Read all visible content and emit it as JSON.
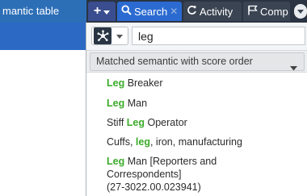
{
  "left_tab": {
    "label": "mantic table"
  },
  "tabs": {
    "add_label": "+",
    "search_label": "Search",
    "search_close": "✕",
    "activity_label": "Activity",
    "comp_label": "Comp"
  },
  "search": {
    "value": "leg"
  },
  "sort": {
    "selected": "Matched semantic with score order"
  },
  "results": [
    {
      "highlight": "Leg",
      "rest": " Breaker"
    },
    {
      "highlight": "Leg",
      "rest": " Man"
    },
    {
      "pre": "Stiff ",
      "highlight": "Leg",
      "rest": " Operator"
    },
    {
      "pre": "Cuffs, ",
      "highlight": "leg",
      "rest": ", iron, manufacturing"
    },
    {
      "highlight": "Leg",
      "rest": " Man [Reporters and",
      "line2": "Correspondents]",
      "line3": "(27-3022.00.023941)"
    }
  ],
  "colors": {
    "highlight": "#3bab2a",
    "tab_active": "#2b6bd1",
    "tabbar_bg": "#2a3442",
    "left_strip": "#2b69c4"
  },
  "icons": {
    "add_caret": "chevron-down-icon",
    "search": "search-icon",
    "activity": "refresh-icon",
    "comp": "flag-icon",
    "overflow": "chevron-down-icon",
    "type": "semantic-type-icon",
    "sort_caret": "caret-down-icon"
  }
}
